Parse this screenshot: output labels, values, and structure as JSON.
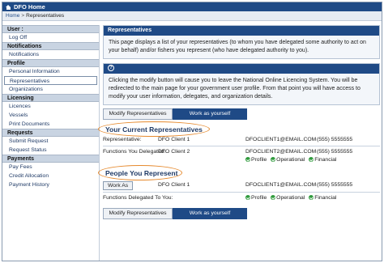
{
  "app": {
    "title": "DFO Home"
  },
  "breadcrumb": {
    "home": "Home",
    "separator": ">",
    "current": "Representatives"
  },
  "sidebar": {
    "sections": [
      {
        "heading": "User :",
        "items": [
          "Log Off"
        ]
      },
      {
        "heading": "Notifications",
        "items": [
          "Notifications"
        ]
      },
      {
        "heading": "Profile",
        "items": [
          "Personal Information",
          "Representatives",
          "Organizations"
        ]
      },
      {
        "heading": "Licensing",
        "items": [
          "Licences",
          "Vessels",
          "Print Documents"
        ]
      },
      {
        "heading": "Requests",
        "items": [
          "Submit Request",
          "Request Status"
        ]
      },
      {
        "heading": "Payments",
        "items": [
          "Pay Fees",
          "Credit Allocation",
          "Payment History"
        ]
      }
    ],
    "active_item": "Representatives"
  },
  "main": {
    "header": "Representatives",
    "intro": "This page displays a list of your representatives (to whom you have delegated some authority to act on your behalf) and/or fishers you represent (who have delegated authority to you).",
    "info_icon_glyph": "?",
    "info": "Clicking the modify button will cause you to leave the National Online Licencing System. You will be redirected to the main page for your government user profile. From that point you will have access to modify your user information, delegates, and organization details.",
    "buttons": {
      "modify": "Modify Representatives",
      "work_as": "Work as yourself"
    },
    "current_reps": {
      "title": "Your Current Representatives",
      "rows": [
        {
          "label": "Representative:",
          "name": "DFO Client 1",
          "email": "DFOCLIENT1@EMAIL.COM",
          "phone": "(555) 5555555"
        },
        {
          "label": "Functions You Delegated:",
          "name": "DFO Client 2",
          "email": "DFOCLIENT2@EMAIL.COM",
          "phone": "(555) 5555555"
        }
      ],
      "delegated_functions": [
        "Profile",
        "Operational",
        "Financial"
      ]
    },
    "people_represent": {
      "title": "People You Represent",
      "work_as_button": "Work As",
      "name": "DFO Client 1",
      "email": "DFOCLIENT1@EMAIL.COM",
      "phone": "(555) 5555555",
      "functions_label": "Functions Delegated To You:",
      "functions": [
        "Profile",
        "Operational",
        "Financial"
      ]
    }
  },
  "colors": {
    "brand_blue": "#1f4a86",
    "highlight_orange": "#e68a2e",
    "check_green": "#2e9a3b"
  }
}
